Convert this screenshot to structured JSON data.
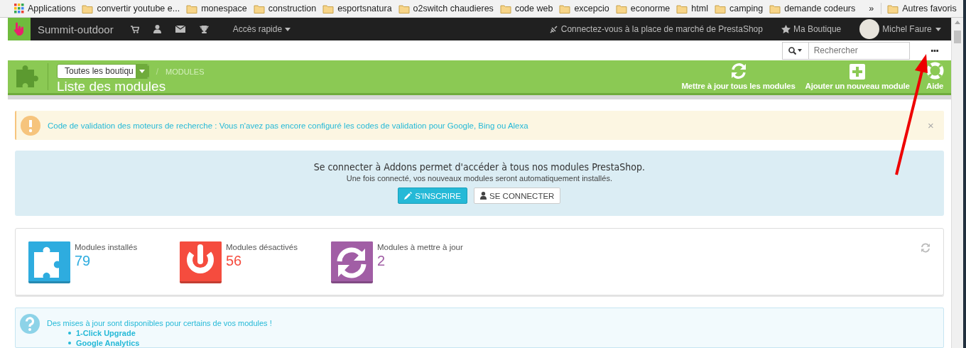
{
  "bookmarks": {
    "apps_label": "Applications",
    "items": [
      {
        "label": "convertir youtube e..."
      },
      {
        "label": "monespace"
      },
      {
        "label": "construction"
      },
      {
        "label": "esportsnatura"
      },
      {
        "label": "o2switch chaudieres"
      },
      {
        "label": "code web"
      },
      {
        "label": "excepcio"
      },
      {
        "label": "econorme"
      },
      {
        "label": "html"
      },
      {
        "label": "camping"
      },
      {
        "label": "demande codeurs"
      }
    ],
    "overflow": "»",
    "other": "Autres favoris"
  },
  "header": {
    "shop_name": "Summit-outdoor",
    "quick_access": "Accès rapide",
    "marketplace": "Connectez-vous à la place de marché de PrestaShop",
    "my_shop": "Ma Boutique",
    "user": "Michel Faure"
  },
  "search": {
    "placeholder": "Rechercher"
  },
  "toolbar": {
    "shop_select": "Toutes les boutiqu",
    "separator": "/",
    "breadcrumb": "MODULES",
    "title": "Liste des modules",
    "actions": [
      {
        "kind": "refresh",
        "label": "Mettre à jour tous les modules"
      },
      {
        "kind": "add",
        "label": "Ajouter un nouveau module"
      },
      {
        "kind": "help",
        "label": "Aide"
      }
    ]
  },
  "warning": {
    "text": "Code de validation des moteurs de recherche : Vous n'avez pas encore configuré les codes de validation pour Google, Bing ou Alexa",
    "close": "×"
  },
  "addons": {
    "title": "Se connecter à Addons permet d'accéder à tous nos modules PrestaShop.",
    "subtitle": "Une fois connecté, vos nouveaux modules seront automatiquement installés.",
    "buttons": [
      {
        "kind": "signup",
        "label": "S'INSCRIRE"
      },
      {
        "kind": "login",
        "label": "SE CONNECTER"
      }
    ]
  },
  "stats": [
    {
      "kind": "installed",
      "label": "Modules installés",
      "count": "79",
      "color": "#2eacdf"
    },
    {
      "kind": "disabled",
      "label": "Modules désactivés",
      "count": "56",
      "color": "#f54c3e"
    },
    {
      "kind": "update",
      "label": "Modules à mettre à jour",
      "count": "2",
      "color": "#a15ea5"
    }
  ],
  "updates": {
    "text": "Des mises à jour sont disponibles pour certains de vos modules !",
    "modules": [
      "1-Click Upgrade",
      "Google Analytics"
    ]
  }
}
